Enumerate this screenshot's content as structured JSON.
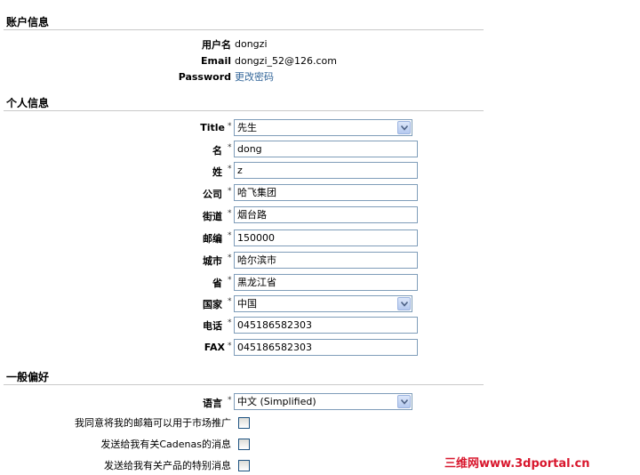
{
  "account": {
    "section_title": "账户信息",
    "username_label": "用户名",
    "username_value": "dongzi",
    "email_label": "Email",
    "email_value": "dongzi_52@126.com",
    "password_label": "Password",
    "password_link": "更改密码"
  },
  "personal": {
    "section_title": "个人信息",
    "required_mark": "*",
    "title_label": "Title",
    "title_value": "先生",
    "first_name_label": "名",
    "first_name_value": "dong",
    "last_name_label": "姓",
    "last_name_value": "z",
    "company_label": "公司",
    "company_value": "哈飞集团",
    "street_label": "街道",
    "street_value": "烟台路",
    "zip_label": "邮编",
    "zip_value": "150000",
    "city_label": "城市",
    "city_value": "哈尔滨市",
    "province_label": "省",
    "province_value": "黑龙江省",
    "country_label": "国家",
    "country_value": "中国",
    "phone_label": "电话",
    "phone_value": "045186582303",
    "fax_label": "FAX",
    "fax_value": "045186582303"
  },
  "preferences": {
    "section_title": "一般偏好",
    "language_label": "语言",
    "language_value": "中文 (Simplified)",
    "marketing_label": "我同意将我的邮箱可以用于市场推广",
    "cadenas_label": "发送给我有关Cadenas的消息",
    "products_label": "发送给我有关产品的特别消息"
  },
  "watermark": "三维网www.3dportal.cn"
}
